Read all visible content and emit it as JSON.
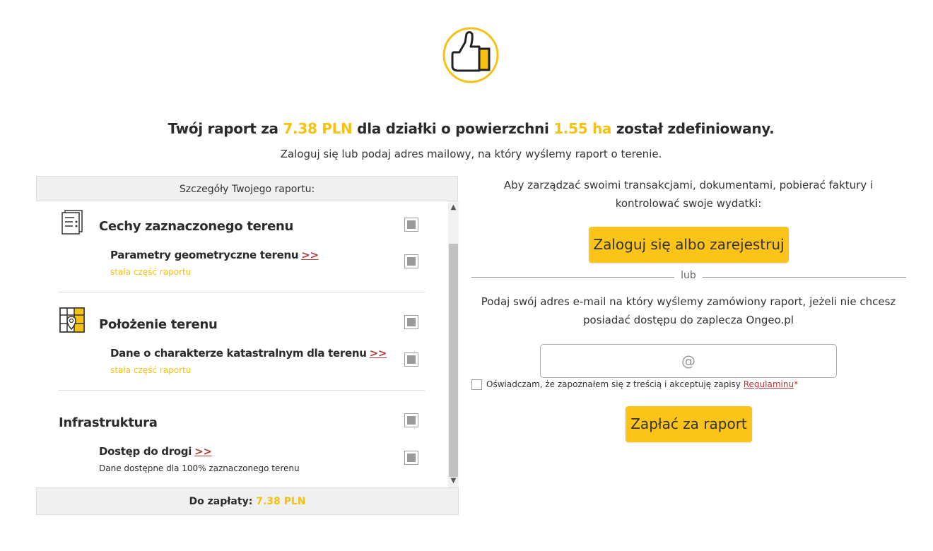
{
  "header": {
    "headline_prefix": "Twój raport za",
    "price": "7.38 PLN",
    "headline_mid": "dla działki o powierzchni",
    "area": "1.55 ha",
    "headline_suffix": "został zdefiniowany.",
    "subline": "Zaloguj się lub podaj adres mailowy, na który wyślemy raport o terenie."
  },
  "details": {
    "title": "Szczegóły Twojego raportu:",
    "sections": [
      {
        "icon": "document-checklist-icon",
        "title": "Cechy zaznaczonego terenu",
        "items": [
          {
            "title": "Parametry geometryczne terenu",
            "more": ">>",
            "sub": "stała część raportu"
          }
        ]
      },
      {
        "icon": "map-location-icon",
        "title": "Położenie terenu",
        "items": [
          {
            "title": "Dane o charakterze katastralnym dla terenu",
            "more": ">>",
            "sub": "stała część raportu"
          }
        ]
      },
      {
        "title": "Infrastruktura",
        "items": [
          {
            "title": "Dostęp do drogi",
            "more": ">>",
            "sub": "Dane dostępne dla 100% zaznaczonego terenu"
          }
        ]
      }
    ],
    "footer_label": "Do zapłaty:",
    "footer_price": "7.38 PLN"
  },
  "account": {
    "manage_text": "Aby zarządzać swoimi transakcjami, dokumentami, pobierać faktury i kontrolować swoje wydatki:",
    "login_button": "Zaloguj się albo zarejestruj",
    "or_label": "lub",
    "email_text": "Podaj swój adres e-mail na który wyślemy zamówiony raport, jeżeli nie chcesz posiadać dostępu do zaplecza Ongeo.pl",
    "email_placeholder": "@",
    "agree_text": "Oświadczam, że zapoznałem się z treścią i akceptuję zapisy",
    "agree_link": "Regulaminu",
    "agree_star": "*",
    "pay_button": "Zapłać za raport"
  },
  "colors": {
    "accent": "#f5c211",
    "button": "#fcc419",
    "link": "#b03a3a"
  }
}
